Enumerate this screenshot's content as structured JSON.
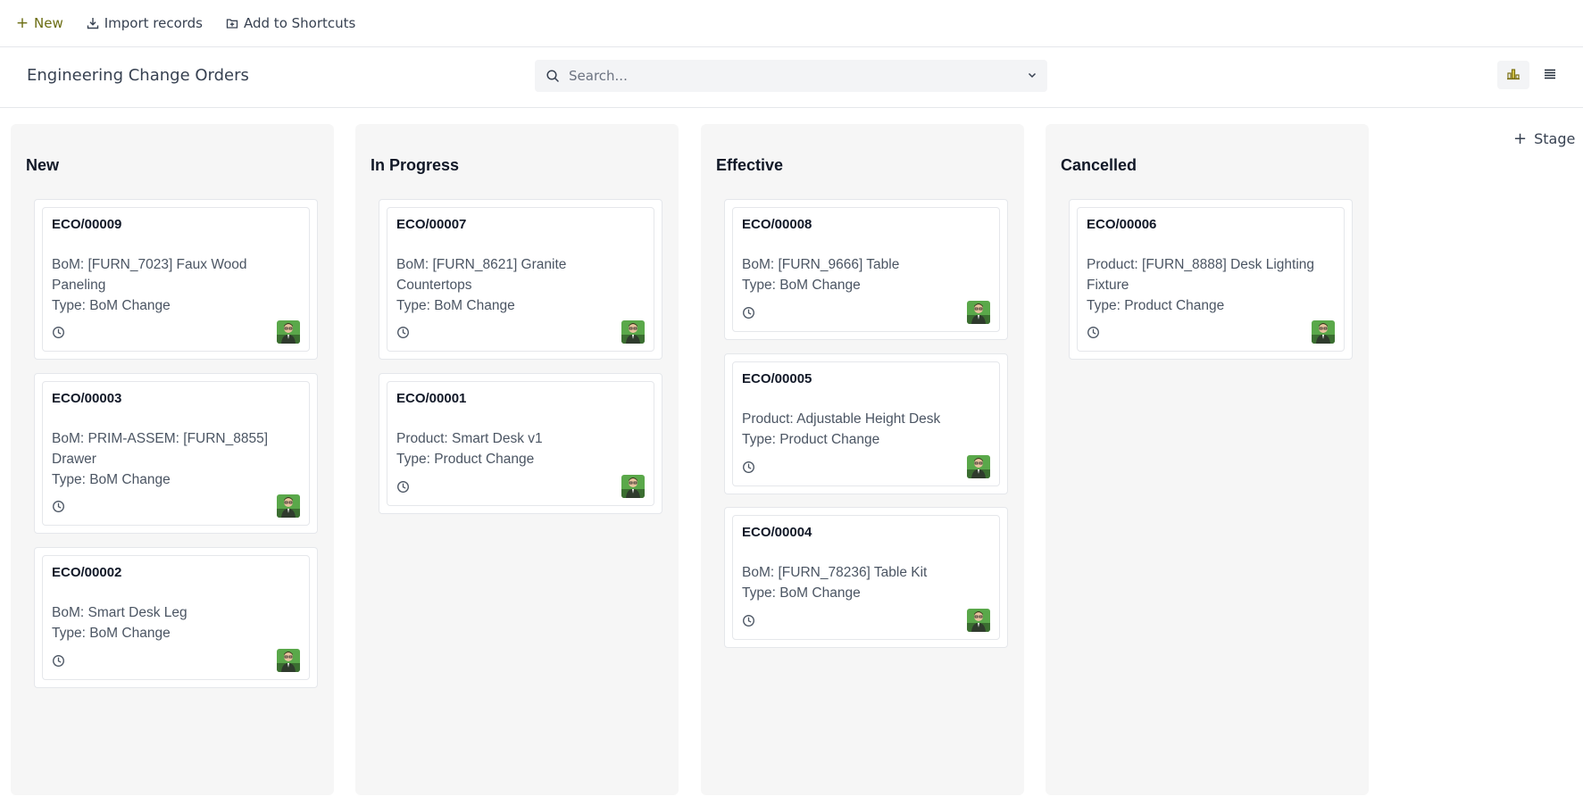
{
  "toolbar": {
    "new_label": "New",
    "import_label": "Import records",
    "shortcut_label": "Add to Shortcuts"
  },
  "header": {
    "title": "Engineering Change Orders",
    "search_placeholder": "Search..."
  },
  "add_stage_label": "Stage",
  "accent_color": "#6b6d12",
  "columns": [
    {
      "title": "New",
      "cards": [
        {
          "id": "ECO/00009",
          "line1": "BoM: [FURN_7023] Faux Wood Paneling",
          "line2": "Type: BoM Change"
        },
        {
          "id": "ECO/00003",
          "line1": "BoM: PRIM-ASSEM: [FURN_8855] Drawer",
          "line2": "Type: BoM Change"
        },
        {
          "id": "ECO/00002",
          "line1": "BoM: Smart Desk Leg",
          "line2": "Type: BoM Change"
        }
      ]
    },
    {
      "title": "In Progress",
      "cards": [
        {
          "id": "ECO/00007",
          "line1": "BoM: [FURN_8621] Granite Countertops",
          "line2": "Type: BoM Change"
        },
        {
          "id": "ECO/00001",
          "line1": "Product: Smart Desk v1",
          "line2": "Type: Product Change"
        }
      ]
    },
    {
      "title": "Effective",
      "cards": [
        {
          "id": "ECO/00008",
          "line1": "BoM: [FURN_9666] Table",
          "line2": "Type: BoM Change"
        },
        {
          "id": "ECO/00005",
          "line1": "Product: Adjustable Height Desk",
          "line2": "Type: Product Change"
        },
        {
          "id": "ECO/00004",
          "line1": "BoM: [FURN_78236] Table Kit",
          "line2": "Type: BoM Change"
        }
      ]
    },
    {
      "title": "Cancelled",
      "cards": [
        {
          "id": "ECO/00006",
          "line1": "Product: [FURN_8888] Desk Lighting Fixture",
          "line2": "Type: Product Change"
        }
      ]
    }
  ]
}
